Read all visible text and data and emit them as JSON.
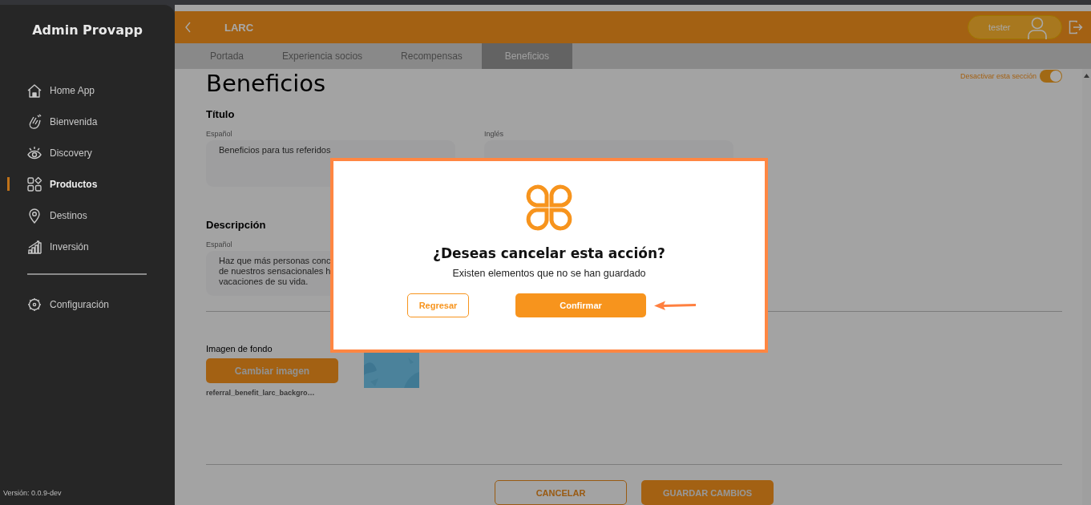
{
  "sidebar": {
    "title": "Admin Provapp",
    "items": [
      {
        "label": "Home App",
        "selected": false
      },
      {
        "label": "Bienvenida",
        "selected": false
      },
      {
        "label": "Discovery",
        "selected": false
      },
      {
        "label": "Productos",
        "selected": true
      },
      {
        "label": "Destinos",
        "selected": false
      },
      {
        "label": "Inversión",
        "selected": false
      }
    ],
    "settings_item": {
      "label": "Configuración",
      "selected": false
    },
    "version": "Versión: 0.0.9-dev"
  },
  "header": {
    "title": "LARC",
    "user": "tester"
  },
  "tabs": [
    {
      "label": "Portada",
      "selected": false
    },
    {
      "label": "Experiencia socios",
      "selected": false
    },
    {
      "label": "Recompensas",
      "selected": false
    },
    {
      "label": "Beneficios",
      "selected": true
    }
  ],
  "page": {
    "heading": "Beneficios",
    "section_toggle": {
      "label": "Desactivar esta sección",
      "on": true
    },
    "title_section": {
      "heading": "Título",
      "fields": [
        {
          "label": "Español",
          "lines": [
            "Beneficios para tus referidos"
          ]
        },
        {
          "label": "Inglés"
        }
      ]
    },
    "description_section": {
      "heading": "Descripción",
      "fields": [
        {
          "label": "Español",
          "lines": [
            "Haz que más personas conc",
            "de nuestros sensacionales h",
            "vacaciones de su vida."
          ]
        }
      ]
    },
    "background_image": {
      "label": "Imagen de fondo",
      "button": "Cambiar imagen",
      "filename": "referral_benefit_larc_backgro…"
    },
    "buttons": [
      {
        "label": "CANCELAR",
        "kind": "secondary"
      },
      {
        "label": "GUARDAR CAMBIOS",
        "kind": "primary"
      }
    ]
  },
  "dialog": {
    "title": "¿Deseas cancelar esta acción?",
    "message": "Existen elementos que no se han guardado",
    "buttons": [
      {
        "label": "Regresar",
        "kind": "secondary"
      },
      {
        "label": "Confirmar",
        "kind": "primary"
      }
    ]
  }
}
